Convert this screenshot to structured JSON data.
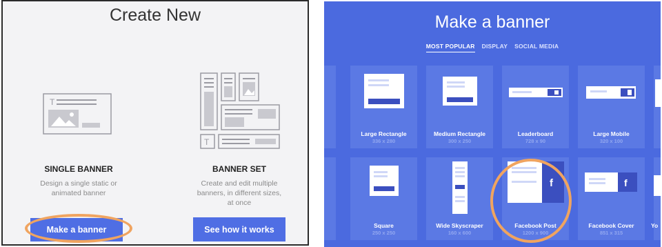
{
  "left": {
    "title": "Create New",
    "single": {
      "title": "SINGLE BANNER",
      "desc_line1": "Design a single static or",
      "desc_line2": "animated banner",
      "button": "Make a banner"
    },
    "set": {
      "title": "BANNER SET",
      "desc_line1": "Create and edit multiple",
      "desc_line2": "banners, in different sizes,",
      "desc_line3": "at once",
      "button": "See how it works"
    }
  },
  "right": {
    "title": "Make a banner",
    "tabs": [
      {
        "label": "MOST POPULAR",
        "active": true
      },
      {
        "label": "DISPLAY",
        "active": false
      },
      {
        "label": "SOCIAL MEDIA",
        "active": false
      }
    ],
    "row1": [
      {
        "name": "Large Rectangle",
        "size": "336 x 280"
      },
      {
        "name": "Medium Rectangle",
        "size": "300 x 250"
      },
      {
        "name": "Leaderboard",
        "size": "728 x 90"
      },
      {
        "name": "Large Mobile",
        "size": "320 x 100"
      }
    ],
    "row2": [
      {
        "name": "Square",
        "size": "250 x 250"
      },
      {
        "name": "Wide Skyscraper",
        "size": "160 x 600"
      },
      {
        "name": "Facebook Post",
        "size": "1200 x 900"
      },
      {
        "name": "Facebook Cover",
        "size": "851 x 315"
      },
      {
        "name": "Yo",
        "size": ""
      }
    ],
    "fb_glyph": "f"
  },
  "colors": {
    "accent": "#4f6ee4",
    "panel_blue": "#4b6adf",
    "tile_blue": "#5b79e4",
    "highlight_ring": "#f0a460",
    "facebook_dark": "#3b4fbf"
  }
}
